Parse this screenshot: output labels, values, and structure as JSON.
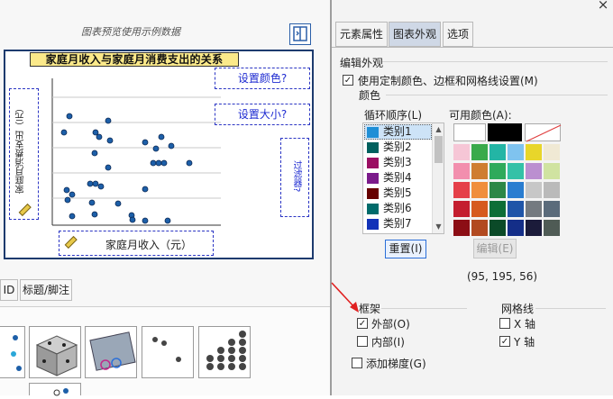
{
  "left_panel": {
    "preview_caption": "图表预览使用示例数据",
    "chart": {
      "title": "家庭月收入与家庭月消费支出的关系",
      "set_color": "设置颜色?",
      "set_size": "设置大小?",
      "y_axis_label": "家庭月消费支出（元）",
      "x_axis_label": "家庭月收入（元）",
      "legend_placeholder": "过滤器?"
    },
    "tabs": [
      {
        "label": "ID"
      },
      {
        "label": "标题/脚注"
      }
    ]
  },
  "right_panel": {
    "close_glyph": "×",
    "tabs": [
      {
        "label": "元素属性"
      },
      {
        "label": "图表外观"
      },
      {
        "label": "选项"
      }
    ],
    "edit_appearance_label": "编辑外观",
    "use_custom_checkbox": {
      "label": "使用定制颜色、边框和网格线设置(M)",
      "checked": true
    },
    "color_group_label": "颜色",
    "cycle_order_label": "循环顺序(L)",
    "available_colors_label": "可用颜色(A):",
    "categories": [
      {
        "label": "类别1",
        "color": "#1f8fd6",
        "selected": true
      },
      {
        "label": "类别2",
        "color": "#00605e"
      },
      {
        "label": "类别3",
        "color": "#9b0f63"
      },
      {
        "label": "类别4",
        "color": "#7b1b8b"
      },
      {
        "label": "类别5",
        "color": "#660000"
      },
      {
        "label": "类别6",
        "color": "#006b6b"
      },
      {
        "label": "类别7",
        "color": "#1232b8"
      }
    ],
    "palette_rows": [
      [
        "#f6c6d6",
        "#39aa4b",
        "#23b5a5",
        "#7fc3ef",
        "#e8d62a",
        "#f0e9d4"
      ],
      [
        "#f28fae",
        "#cf7d31",
        "#2faa5b",
        "#34c1a7",
        "#bb8fd0",
        "#d0e3a1"
      ],
      [
        "#e54049",
        "#f08e3c",
        "#2c8747",
        "#2a7dd0",
        "#c7c7c7",
        "#bababa"
      ],
      [
        "#c41e2f",
        "#d65a1e",
        "#0d6e37",
        "#1f55a8",
        "#747a80",
        "#5a6b7b"
      ],
      [
        "#8c0e15",
        "#b24a20",
        "#0b4a28",
        "#142e88",
        "#1b1b3a",
        "#4f5b55"
      ]
    ],
    "reset_button": "重置(I)",
    "edit_button": "编辑(E)",
    "rgb_readout": "(95, 195, 56)",
    "frame_group_label": "框架",
    "outer_checkbox": {
      "label": "外部(O)",
      "checked": true
    },
    "inner_checkbox": {
      "label": "内部(I)",
      "checked": false
    },
    "grid_group_label": "网格线",
    "x_axis_checkbox": {
      "label": "X 轴",
      "checked": false
    },
    "y_axis_checkbox": {
      "label": "Y 轴",
      "checked": true
    },
    "add_gradient_checkbox": {
      "label": "添加梯度(G)",
      "checked": false
    }
  }
}
